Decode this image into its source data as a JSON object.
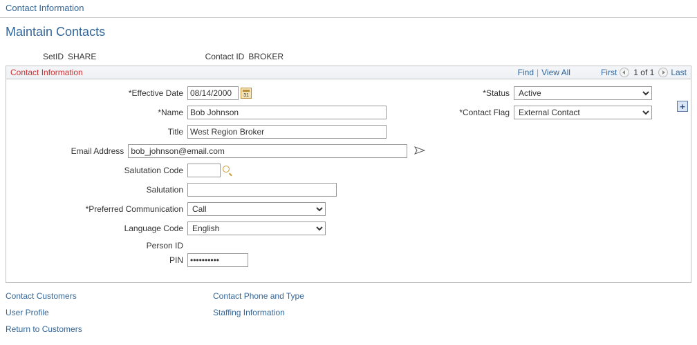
{
  "breadcrumb": "Contact Information",
  "page_title": "Maintain Contacts",
  "header": {
    "setid_label": "SetID",
    "setid_value": "SHARE",
    "contactid_label": "Contact ID",
    "contactid_value": "BROKER"
  },
  "panel": {
    "title": "Contact Information",
    "nav": {
      "find": "Find",
      "view_all": "View All",
      "first": "First",
      "position": "1 of 1",
      "last": "Last"
    }
  },
  "form": {
    "effective_date_label": "*Effective Date",
    "effective_date_value": "08/14/2000",
    "name_label": "*Name",
    "name_value": "Bob Johnson",
    "title_label": "Title",
    "title_value": "West Region Broker",
    "email_label": "Email Address",
    "email_value": "bob_johnson@email.com",
    "salutation_code_label": "Salutation Code",
    "salutation_code_value": "",
    "salutation_label": "Salutation",
    "salutation_value": "",
    "preferred_comm_label": "*Preferred Communication",
    "preferred_comm_value": "Call",
    "language_code_label": "Language Code",
    "language_code_value": "English",
    "person_id_label": "Person ID",
    "person_id_value": "",
    "pin_label": "PIN",
    "pin_value": "••••••••••",
    "status_label": "*Status",
    "status_value": "Active",
    "contact_flag_label": "*Contact Flag",
    "contact_flag_value": "External Contact"
  },
  "links": {
    "contact_customers": "Contact Customers",
    "user_profile": "User Profile",
    "return_to_customers": "Return to Customers",
    "contact_phone": "Contact Phone and Type",
    "staffing_info": "Staffing Information"
  }
}
